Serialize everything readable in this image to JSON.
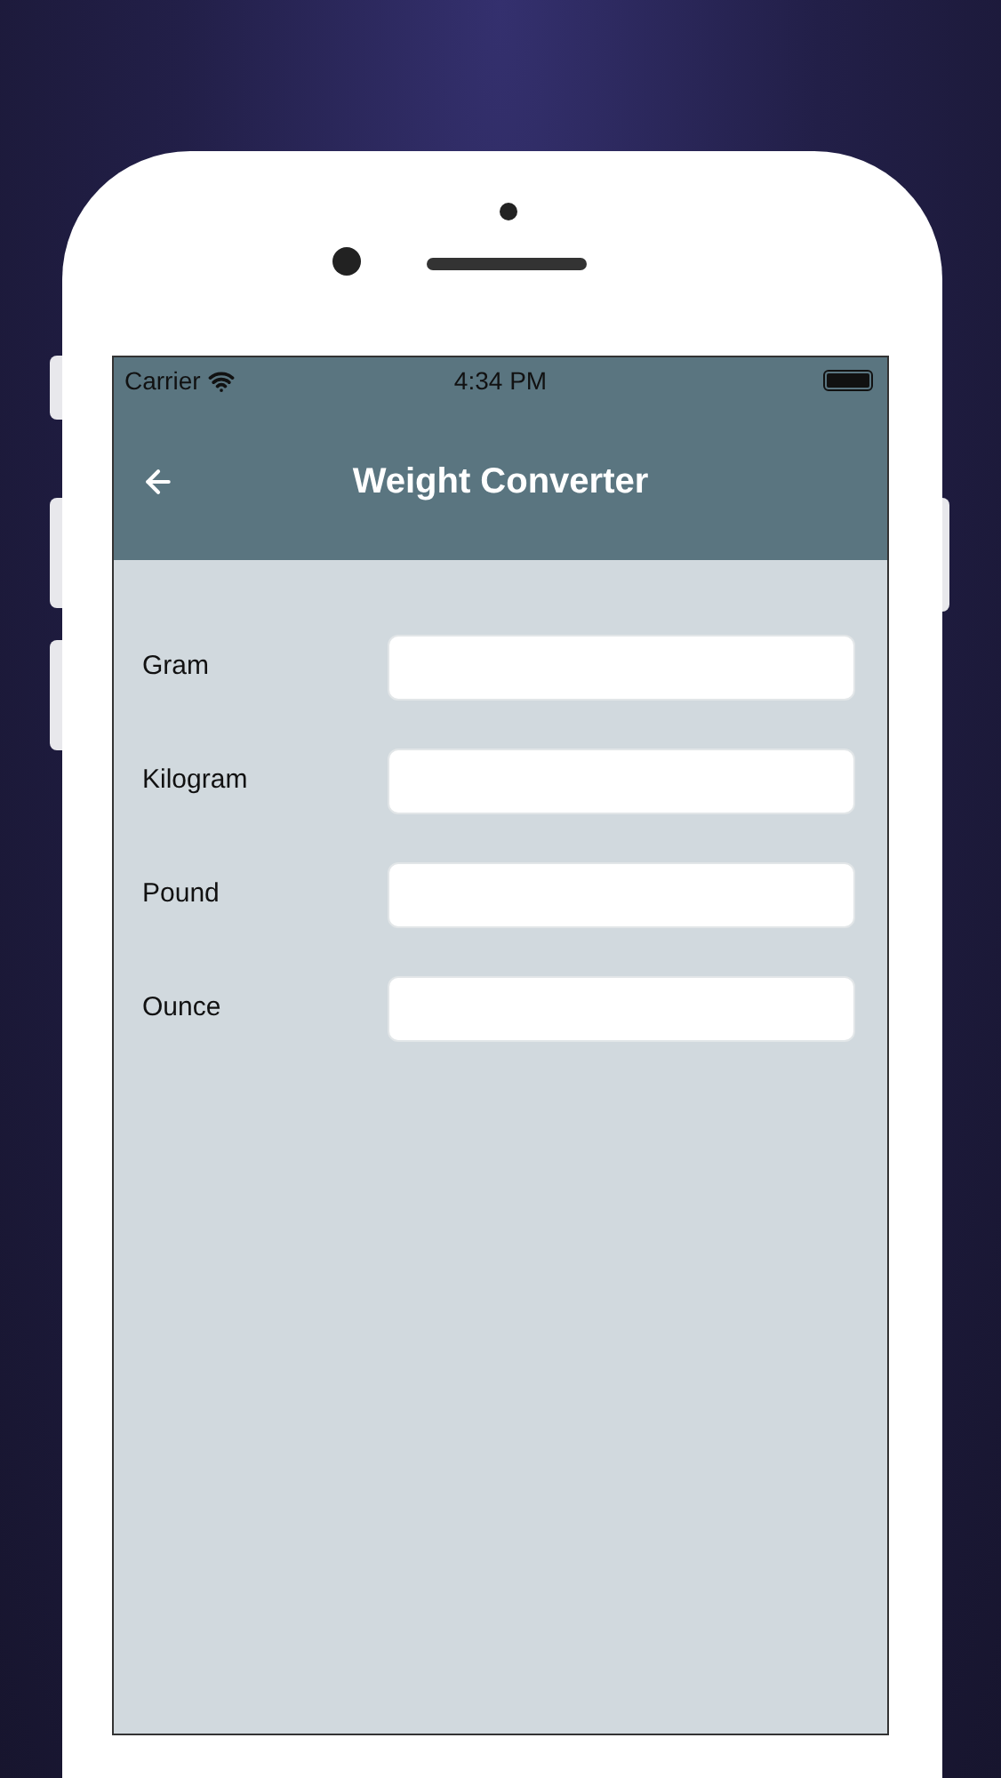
{
  "status_bar": {
    "carrier": "Carrier",
    "time": "4:34 PM"
  },
  "header": {
    "title": "Weight Converter"
  },
  "fields": [
    {
      "label": "Gram"
    },
    {
      "label": "Kilogram"
    },
    {
      "label": "Pound"
    },
    {
      "label": "Ounce"
    }
  ]
}
